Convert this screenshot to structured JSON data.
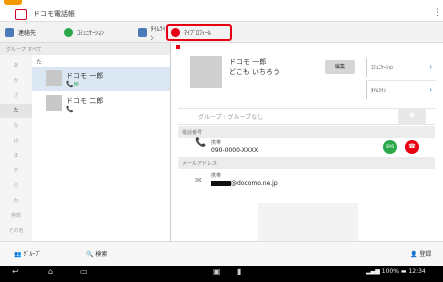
{
  "app": {
    "title": "ドコモ電話帳",
    "menu": "⋮"
  },
  "tabs": [
    {
      "label": "連絡先",
      "color": "#4a7ab8"
    },
    {
      "label": "ｺﾐｭﾆｹｰｼｮﾝ",
      "color": "#2aa84a"
    },
    {
      "label": "ﾀｲﾑﾗｲﾝ",
      "color": "#4a7ab8"
    },
    {
      "label": "ﾏｲﾌﾟﾛﾌｨｰﾙ",
      "color": "#e60012"
    }
  ],
  "left": {
    "group_label": "グループ すべて",
    "index_section": "た",
    "index": [
      "あ",
      "か",
      "さ",
      "た",
      "な",
      "は",
      "ま",
      "や",
      "ら",
      "わ",
      "英数",
      "その他"
    ],
    "contacts": [
      {
        "name": "ドコモ 一郎",
        "icons": "📞✉"
      },
      {
        "name": "ドコモ 二郎",
        "icons": "📞"
      }
    ]
  },
  "detail": {
    "name": "ドコモ 一郎",
    "kana": "どこも いちろう",
    "edit": "編集",
    "side_buttons": [
      "ｺﾐｭﾆｹｰｼｮﾝ",
      "ﾀｲﾑﾗｲﾝ"
    ],
    "group": "グループ : グループなし",
    "star": "★",
    "phone_section": "電話番号",
    "phone_type": "携帯",
    "phone_number": "090-0000-XXXX",
    "sms": "SMS",
    "mail_section": "メールアドレス",
    "mail_type": "携帯",
    "mail_address": "@docomo.ne.jp"
  },
  "toolbar": {
    "group": "ｸﾞﾙｰﾌﾟ",
    "search": "検索",
    "register": "登録"
  },
  "status": {
    "battery": "100%",
    "time": "12:34"
  }
}
